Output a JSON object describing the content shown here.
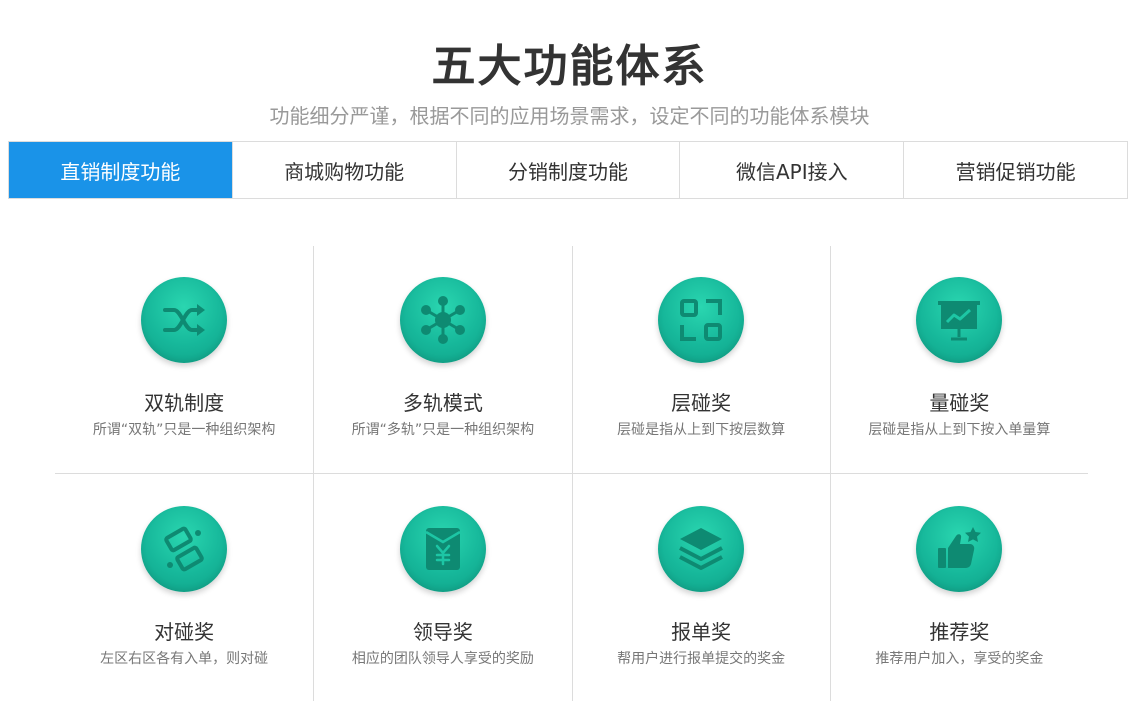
{
  "header": {
    "title": "五大功能体系",
    "subtitle": "功能细分严谨，根据不同的应用场景需求，设定不同的功能体系模块"
  },
  "tabs": [
    {
      "label": "直销制度功能",
      "active": true
    },
    {
      "label": "商城购物功能",
      "active": false
    },
    {
      "label": "分销制度功能",
      "active": false
    },
    {
      "label": "微信API接入",
      "active": false
    },
    {
      "label": "营销促销功能",
      "active": false
    }
  ],
  "colors": {
    "accent": "#1a93e8",
    "icon_green": "#16b79a",
    "icon_glyph": "#0e8a72"
  },
  "features": [
    {
      "title": "双轨制度",
      "desc": "所谓“双轨”只是一种组织架构",
      "icon": "shuffle-icon"
    },
    {
      "title": "多轨模式",
      "desc": "所谓“多轨”只是一种组织架构",
      "icon": "network-hub-icon"
    },
    {
      "title": "层碰奖",
      "desc": "层碰是指从上到下按层数算",
      "icon": "scan-frame-icon"
    },
    {
      "title": "量碰奖",
      "desc": "层碰是指从上到下按入单量算",
      "icon": "presentation-chart-icon"
    },
    {
      "title": "对碰奖",
      "desc": "左区右区各有入单，则对碰",
      "icon": "linked-squares-icon"
    },
    {
      "title": "领导奖",
      "desc": "相应的团队领导人享受的奖励",
      "icon": "red-envelope-yen-icon"
    },
    {
      "title": "报单奖",
      "desc": "帮用户进行报单提交的奖金",
      "icon": "layers-icon"
    },
    {
      "title": "推荐奖",
      "desc": "推荐用户加入，享受的奖金",
      "icon": "thumbs-up-star-icon"
    }
  ]
}
